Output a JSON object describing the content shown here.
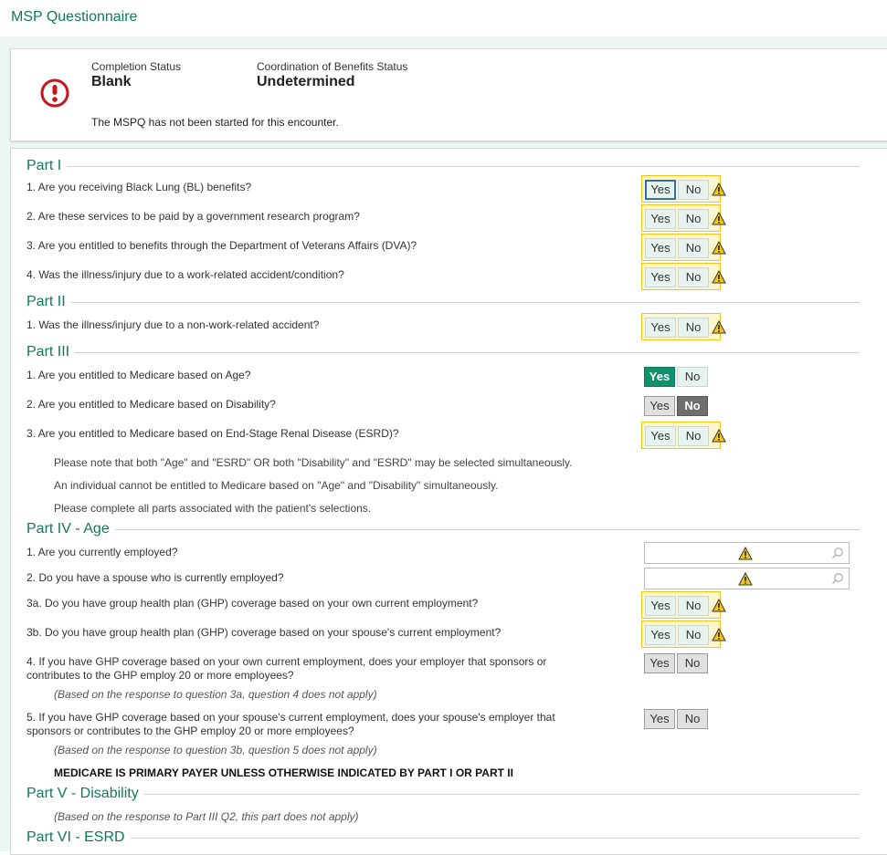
{
  "app": {
    "title": "MSP Questionnaire"
  },
  "status": {
    "completion_label": "Completion Status",
    "completion_value": "Blank",
    "cob_label": "Coordination of Benefits Status",
    "cob_value": "Undetermined",
    "message": "The MSPQ has not been started for this encounter."
  },
  "colors": {
    "accent": "#0e7a5b",
    "selected_yes": "#11906d",
    "warning": "#f0c419",
    "alert": "#c4161c"
  },
  "buttons": {
    "yes": "Yes",
    "no": "No"
  },
  "part1": {
    "title": "Part I",
    "q1": "1. Are you receiving Black Lung (BL) benefits?",
    "q2": "2. Are these services to be paid by a government research program?",
    "q3": "3. Are you entitled to benefits through the Department of Veterans Affairs (DVA)?",
    "q4": "4. Was the illness/injury due to a work-related accident/condition?"
  },
  "part2": {
    "title": "Part II",
    "q1": "1. Was the illness/injury due to a non-work-related accident?"
  },
  "part3": {
    "title": "Part III",
    "q1": "1. Are you entitled to Medicare based on Age?",
    "q1_selected": "Yes",
    "q2": "2. Are you entitled to Medicare based on Disability?",
    "q2_selected": "No",
    "q3": "3. Are you entitled to Medicare based on End-Stage Renal Disease (ESRD)?",
    "note1": "Please note that both \"Age\" and \"ESRD\" OR both \"Disability\" and \"ESRD\" may be selected simultaneously.",
    "note2": "An individual cannot be entitled to Medicare based on \"Age\" and \"Disability\" simultaneously.",
    "note3": "Please complete all parts associated with the patient's selections."
  },
  "part4": {
    "title": "Part IV - Age",
    "q1": "1. Are you currently employed?",
    "q2": "2. Do you have a spouse who is currently employed?",
    "q3a": "3a. Do you have group health plan (GHP) coverage based on your own current employment?",
    "q3b": "3b. Do you have group health plan (GHP) coverage based on your spouse's current employment?",
    "q4_line1": "4. If you have GHP coverage based on your own current employment, does your employer that sponsors or",
    "q4_line2": "contributes to the GHP employ 20 or more employees?",
    "q4_note": "(Based on the response to question 3a, question 4 does not apply)",
    "q5_line1": "5. If you have GHP coverage based on your spouse's current employment, does your spouse's employer that",
    "q5_line2": "sponsors or contributes to the GHP employ 20 or more employees?",
    "q5_note": "(Based on the response to question 3b, question 5 does not apply)",
    "primary_note": "MEDICARE IS PRIMARY PAYER UNLESS OTHERWISE INDICATED BY PART I OR PART II"
  },
  "part5": {
    "title": "Part V - Disability",
    "note": "(Based on the response to Part III Q2, this part does not apply)"
  },
  "part6": {
    "title": "Part VI - ESRD"
  }
}
